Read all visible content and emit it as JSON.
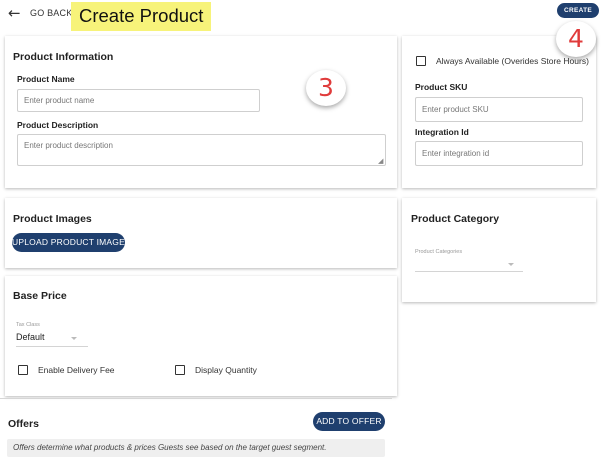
{
  "header": {
    "back_label": "GO BACK",
    "title": "Create Product",
    "create_label": "CREATE",
    "title_highlight_color": "#f7f37a",
    "accent_color": "#1f3f6e"
  },
  "callouts": {
    "three": "3",
    "four": "4",
    "color": "#e03b3b"
  },
  "product_information": {
    "title": "Product Information",
    "name_label": "Product Name",
    "name_placeholder": "Enter product name",
    "description_label": "Product Description",
    "description_placeholder": "Enter product description"
  },
  "availability": {
    "always_available_label": "Always Available (Overides Store Hours)",
    "sku_label": "Product SKU",
    "sku_placeholder": "Enter product SKU",
    "integration_label": "Integration Id",
    "integration_placeholder": "Enter integration id"
  },
  "product_images": {
    "title": "Product Images",
    "upload_label": "UPLOAD PRODUCT IMAGE"
  },
  "product_category": {
    "title": "Product Category",
    "select_label": "Product Categories"
  },
  "base_price": {
    "title": "Base Price",
    "tax_class_label": "Tax Class",
    "tax_class_value": "Default",
    "delivery_fee_label": "Enable Delivery Fee",
    "display_quantity_label": "Display Quantity"
  },
  "offers": {
    "title": "Offers",
    "add_label": "ADD TO OFFER",
    "note": "Offers determine what products & prices Guests see based on the target guest segment."
  }
}
